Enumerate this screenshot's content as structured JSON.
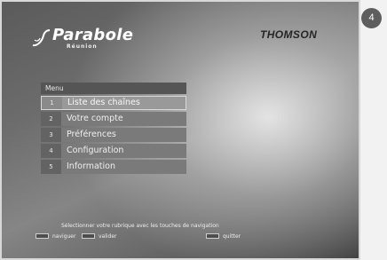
{
  "header": {
    "logo_name": "Parabole",
    "logo_subtitle": "Réunion",
    "brand": "THOMSON"
  },
  "menu": {
    "title": "Menu",
    "selected_index": 0,
    "items": [
      {
        "number": "1",
        "label": "Liste des chaînes"
      },
      {
        "number": "2",
        "label": "Votre compte"
      },
      {
        "number": "3",
        "label": "Préférences"
      },
      {
        "number": "4",
        "label": "Configuration"
      },
      {
        "number": "5",
        "label": "Information"
      }
    ]
  },
  "footer": {
    "hint": "Sélectionner votre rubrique avec les touches de navigation",
    "keys": [
      {
        "label": "naviguer"
      },
      {
        "label": "valider"
      },
      {
        "label": "quitter"
      }
    ]
  },
  "step_badge": "4",
  "colors": {
    "menu_item": "#7a7a7a",
    "menu_item_selected": "#999999",
    "menu_title": "#555555",
    "badge": "#5e5e5e"
  }
}
